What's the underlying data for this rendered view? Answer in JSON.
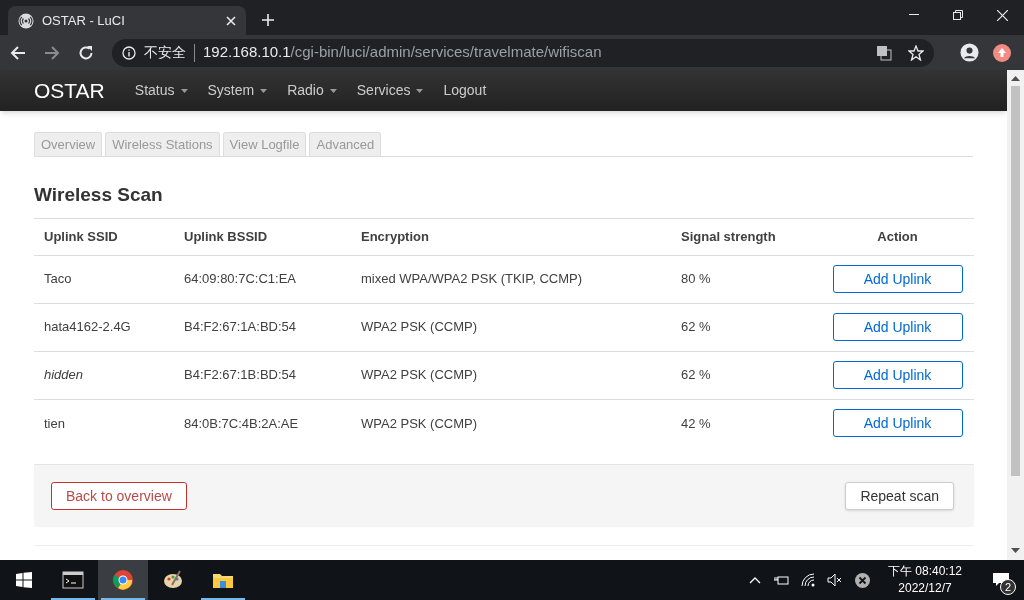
{
  "browser": {
    "tab_title": "OSTAR - LuCI",
    "security_label": "不安全",
    "url_host": "192.168.10.1",
    "url_path": "/cgi-bin/luci/admin/services/travelmate/wifiscan"
  },
  "navbar": {
    "brand": "OSTAR",
    "menu": [
      {
        "label": "Status",
        "dropdown": true
      },
      {
        "label": "System",
        "dropdown": true
      },
      {
        "label": "Radio",
        "dropdown": true
      },
      {
        "label": "Services",
        "dropdown": true
      },
      {
        "label": "Logout",
        "dropdown": false
      }
    ]
  },
  "tabs": [
    {
      "label": "Overview",
      "selected": false
    },
    {
      "label": "Wireless Stations",
      "selected": false
    },
    {
      "label": "View Logfile",
      "selected": false
    },
    {
      "label": "Advanced",
      "selected": false
    }
  ],
  "section_title": "Wireless Scan",
  "table": {
    "columns": [
      "Uplink SSID",
      "Uplink BSSID",
      "Encryption",
      "Signal strength",
      "Action"
    ],
    "rows": [
      {
        "ssid": "Taco",
        "italic": false,
        "bssid": "64:09:80:7C:C1:EA",
        "encryption": "mixed WPA/WPA2 PSK (TKIP, CCMP)",
        "signal": "80 %",
        "action": "Add Uplink"
      },
      {
        "ssid": "hata4162-2.4G",
        "italic": false,
        "bssid": "B4:F2:67:1A:BD:54",
        "encryption": "WPA2 PSK (CCMP)",
        "signal": "62 %",
        "action": "Add Uplink"
      },
      {
        "ssid": "hidden",
        "italic": true,
        "bssid": "B4:F2:67:1B:BD:54",
        "encryption": "WPA2 PSK (CCMP)",
        "signal": "62 %",
        "action": "Add Uplink"
      },
      {
        "ssid": "tien",
        "italic": false,
        "bssid": "84:0B:7C:4B:2A:AE",
        "encryption": "WPA2 PSK (CCMP)",
        "signal": "42 %",
        "action": "Add Uplink"
      }
    ]
  },
  "footer_buttons": {
    "back": "Back to overview",
    "repeat": "Repeat scan"
  },
  "taskbar": {
    "time": "下午 08:40:12",
    "date": "2022/12/7",
    "notifications": "2",
    "apps": [
      {
        "kind": "terminal",
        "active": false,
        "open": true
      },
      {
        "kind": "browser",
        "active": true,
        "open": true
      },
      {
        "kind": "paint",
        "active": false,
        "open": false
      },
      {
        "kind": "folder",
        "active": false,
        "open": true
      }
    ]
  }
}
